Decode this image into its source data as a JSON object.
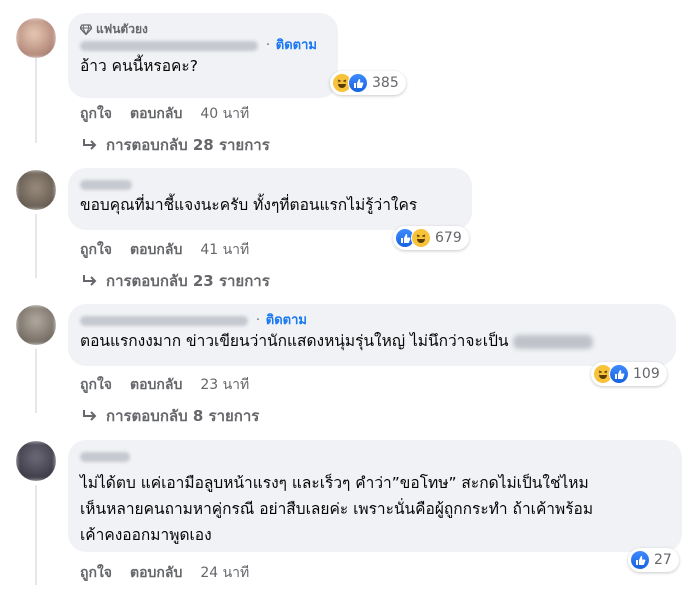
{
  "comments": [
    {
      "fan_badge": "แฟนตัวยง",
      "follow_label": "ติดตาม",
      "separator": "·",
      "text": "อ้าว คนนี้หรอคะ?",
      "reaction_count": "385",
      "reactions": [
        "haha-icon",
        "like-icon"
      ],
      "like_label": "ถูกใจ",
      "reply_label": "ตอบกลับ",
      "time": "40 นาที",
      "replies_label": "การตอบกลับ 28 รายการ"
    },
    {
      "text": "ขอบคุณที่มาชี้แจงนะครับ ทั้งๆที่ตอนแรกไม่รู้ว่าใคร",
      "reaction_count": "679",
      "reactions": [
        "like-icon",
        "haha-icon"
      ],
      "like_label": "ถูกใจ",
      "reply_label": "ตอบกลับ",
      "time": "41 นาที",
      "replies_label": "การตอบกลับ 23 รายการ"
    },
    {
      "follow_label": "ติดตาม",
      "separator": "·",
      "text": "ตอนแรกงงมาก ข่าวเขียนว่านักแสดงหนุ่มรุ่นใหญ่ ไม่นึกว่าจะเป็น",
      "reaction_count": "109",
      "reactions": [
        "haha-icon",
        "like-icon"
      ],
      "like_label": "ถูกใจ",
      "reply_label": "ตอบกลับ",
      "time": "23 นาที",
      "replies_label": "การตอบกลับ 8 รายการ"
    },
    {
      "text_lines": [
        "ไม่ได้ตบ แค่เอามือลูบหน้าแรงๆ และเร็วๆ คำว่า”ขอโทษ” สะกดไม่เป็นใช่ไหม",
        "เห็นหลายคนถามหาคู่กรณี อย่าสืบเลยค่ะ เพราะนั่นคือผู้ถูกกระทำ ถ้าเค้าพร้อม",
        "เค้าคงออกมาพูดเอง"
      ],
      "reaction_count": "27",
      "reactions": [
        "like-icon"
      ],
      "like_label": "ถูกใจ",
      "reply_label": "ตอบกลับ",
      "time": "24 นาที"
    }
  ],
  "colors": {
    "link": "#1877f2",
    "bubble": "#f0f2f5",
    "secondary": "#65676b"
  }
}
